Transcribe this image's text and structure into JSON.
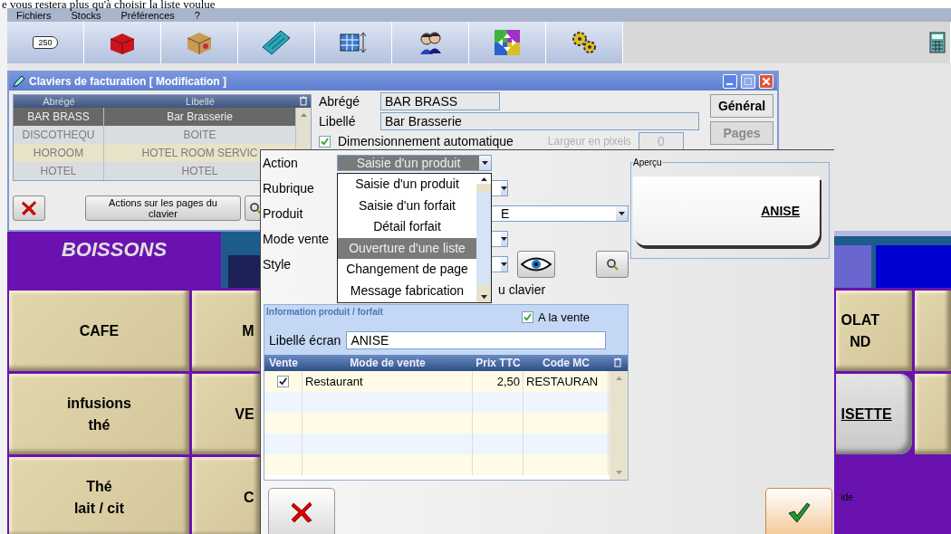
{
  "caption": "e vous restera plus qu'à choisir la liste voulue",
  "menu": [
    {
      "label": "Fichiers"
    },
    {
      "label": "Stocks"
    },
    {
      "label": "Préférences"
    },
    {
      "label": "?"
    }
  ],
  "toolbar": {
    "tag_text": "250"
  },
  "window": {
    "title": "Claviers de facturation  [ Modification ]",
    "grid": {
      "columns": [
        "Abrégé",
        "Libellé"
      ],
      "rows": [
        {
          "abrege": "BAR BRASS",
          "libelle": "Bar Brasserie",
          "selected": true
        },
        {
          "abrege": "DISCOTHEQU",
          "libelle": "BOITE",
          "selected": false
        },
        {
          "abrege": "HOROOM",
          "libelle": "HOTEL ROOM SERVIC",
          "selected": false
        },
        {
          "abrege": "HOTEL",
          "libelle": "HOTEL",
          "selected": false
        }
      ]
    },
    "actions_button": "Actions sur les pages du clavier",
    "abrege": {
      "label": "Abrégé",
      "value": "BAR BRASS"
    },
    "libelle": {
      "label": "Libellé",
      "value": "Bar Brasserie"
    },
    "auto_size": {
      "label": "Dimensionnement automatique",
      "checked": true
    },
    "width_field": {
      "label": "Largeur en pixels",
      "value": "0",
      "disabled": true
    },
    "tabs": [
      {
        "label": "Général",
        "selected": true,
        "disabled": false
      },
      {
        "label": "Pages",
        "selected": false,
        "disabled": true
      }
    ]
  },
  "keypad": {
    "category": "BOISSONS",
    "rows": [
      [
        {
          "label": "CAFE",
          "kind": "tan"
        },
        {
          "label": "M",
          "kind": "tan"
        },
        {
          "label": "OLAT\nND",
          "kind": "tan"
        },
        {
          "kind": "tan"
        }
      ],
      [
        {
          "label": "infusions\nthé",
          "kind": "tan"
        },
        {
          "label": "VE",
          "kind": "tan"
        },
        {
          "label": "ISETTE",
          "kind": "gray"
        },
        {
          "kind": "tan"
        }
      ],
      [
        {
          "label": "Thé\nlait / cit",
          "kind": "tan"
        },
        {
          "label": "C",
          "kind": "tan"
        },
        {
          "label": "ide",
          "kind": "empty"
        },
        {
          "kind": "empty"
        }
      ]
    ]
  },
  "dialog": {
    "fields": [
      {
        "label": "Action",
        "value": "Saisie d'un produit"
      },
      {
        "label": "Rubrique"
      },
      {
        "label": "Produit",
        "value": "E"
      },
      {
        "label": "Mode vente"
      },
      {
        "label": "Style"
      }
    ],
    "clavier_option": "u clavier",
    "dropdown": [
      {
        "label": "Saisie d'un produit",
        "selected": false
      },
      {
        "label": "Saisie d'un forfait",
        "selected": false
      },
      {
        "label": "Détail forfait",
        "selected": false
      },
      {
        "label": "Ouverture d'une liste",
        "selected": true
      },
      {
        "label": "Changement de page",
        "selected": false
      },
      {
        "label": "Message fabrication",
        "selected": false
      }
    ],
    "preview": {
      "title": "Aperçu",
      "button": "ANISE"
    },
    "info": {
      "title": "Information produit / forfait",
      "on_sale": {
        "label": "A la vente",
        "checked": true
      },
      "screen_label": {
        "label": "Libellé écran",
        "value": "ANISE"
      },
      "table": {
        "columns": [
          "Vente",
          "Mode de vente",
          "Prix TTC",
          "Code MC"
        ],
        "rows": [
          {
            "checked": true,
            "mode": "Restaurant",
            "price": "2,50",
            "code": "RESTAURAN"
          }
        ]
      }
    }
  }
}
